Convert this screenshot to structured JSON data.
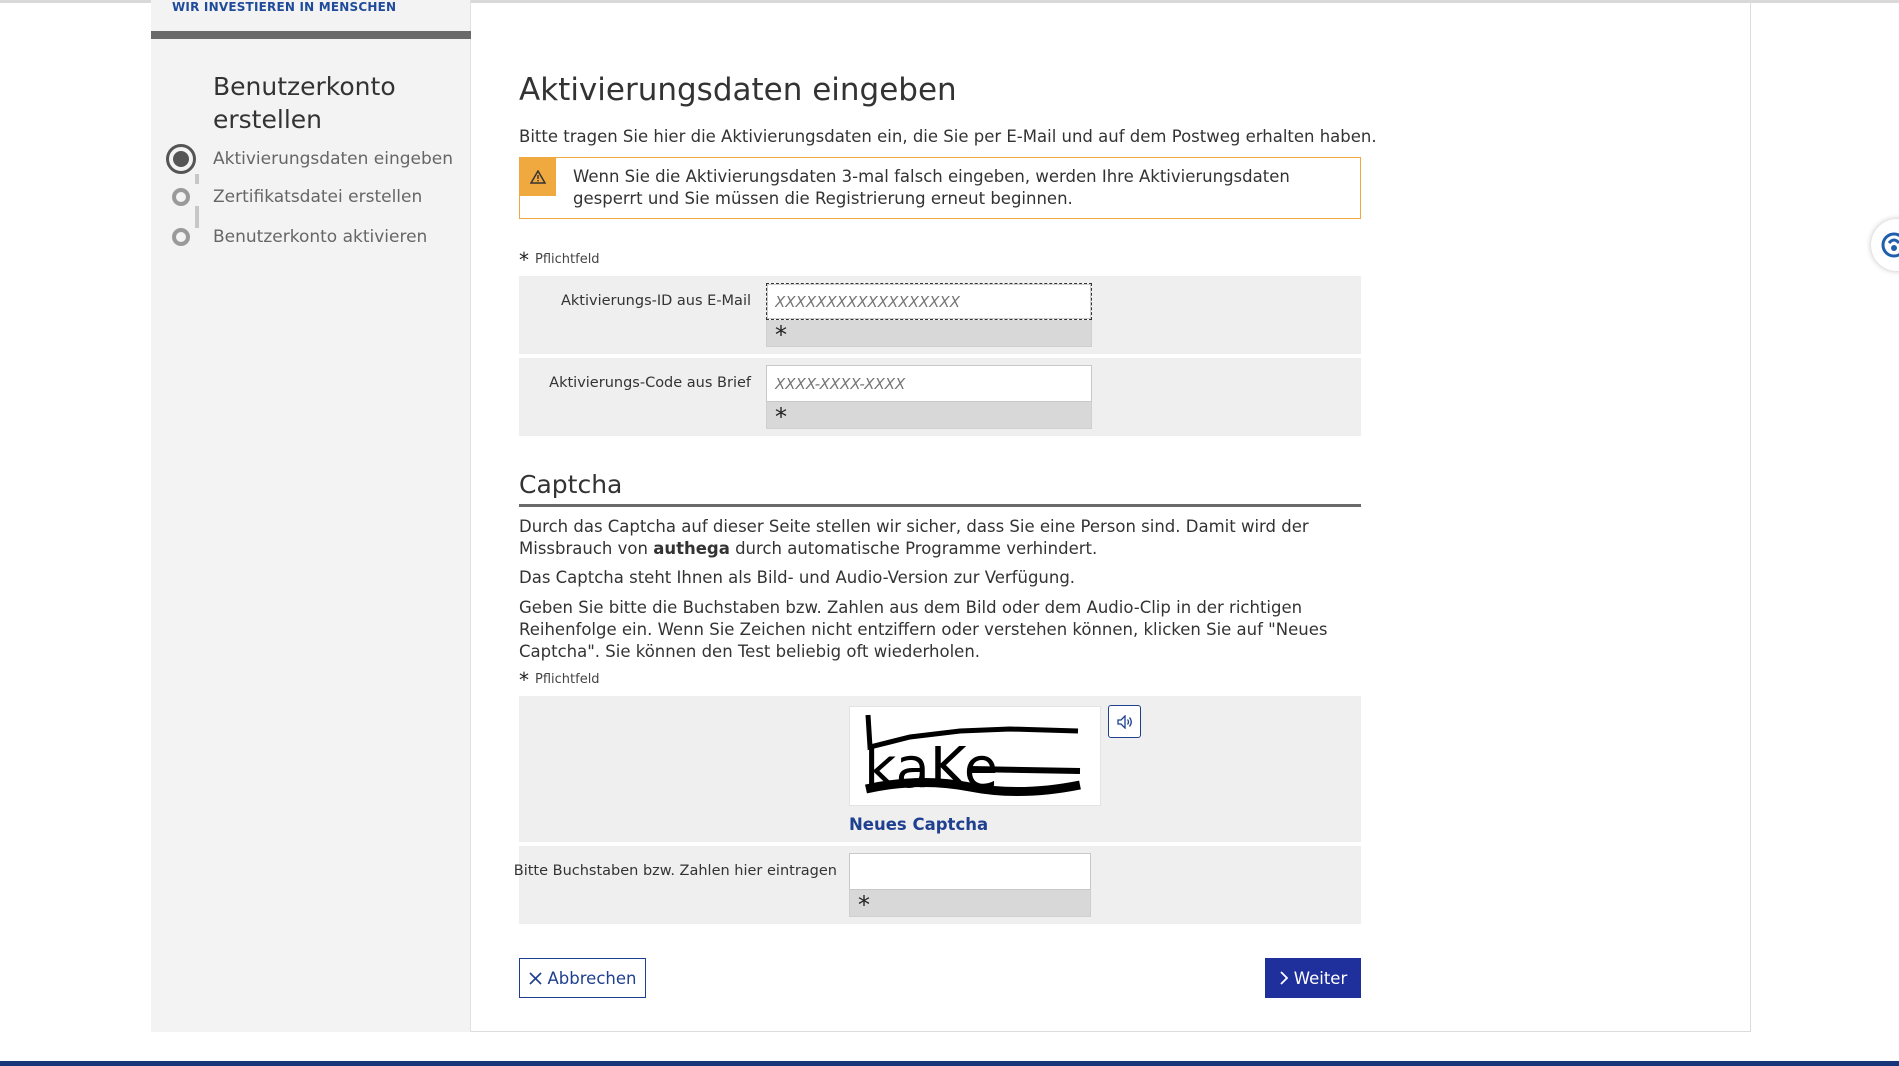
{
  "sidebar": {
    "brand": "WIR INVESTIEREN IN MENSCHEN",
    "title": "Benutzerkonto erstellen",
    "steps": [
      {
        "label": "Aktivierungsdaten eingeben"
      },
      {
        "label": "Zertifikatsdatei erstellen"
      },
      {
        "label": "Benutzerkonto aktivieren"
      }
    ]
  },
  "main": {
    "title": "Aktivierungsdaten eingeben",
    "intro": "Bitte tragen Sie hier die Aktivierungsdaten ein, die Sie per E-Mail und auf dem Postweg erhalten haben.",
    "warning": "Wenn Sie die Aktivierungsdaten 3-mal falsch eingeben, werden Ihre Aktivierungsdaten gesperrt und Sie müssen die Registrierung erneut beginnen.",
    "required_note": "Pflichtfeld",
    "required_star": "*",
    "fields": [
      {
        "label": "Aktivierungs-ID aus E-Mail",
        "placeholder": "XXXXXXXXXXXXXXXXXX",
        "value": ""
      },
      {
        "label": "Aktivierungs-Code aus Brief",
        "placeholder": "XXXX-XXXX-XXXX",
        "value": ""
      }
    ]
  },
  "captcha": {
    "title": "Captcha",
    "p1_a": "Durch das Captcha auf dieser Seite stellen wir sicher, dass Sie eine Person sind. Damit wird der Missbrauch von ",
    "p1_bold": "authega",
    "p1_b": " durch automatische Programme verhindert.",
    "p2": "Das Captcha steht Ihnen als Bild- und Audio-Version zur Verfügung.",
    "p3": "Geben Sie bitte die Buchstaben bzw. Zahlen aus dem Bild oder dem Audio-Clip in der richtigen Reihenfolge ein. Wenn Sie Zeichen nicht entziffern oder verstehen können, klicken Sie auf \"Neues Captcha\". Sie können den Test beliebig oft wiederholen.",
    "required_note": "Pflichtfeld",
    "image_text": "kaKe",
    "new_captcha": "Neues Captcha",
    "input_label": "Bitte Buchstaben bzw. Zahlen hier eintragen",
    "input_value": ""
  },
  "buttons": {
    "cancel": "Abbrechen",
    "next": "Weiter"
  },
  "colors": {
    "primary": "#1f2f9c",
    "link": "#1f3f8f",
    "warning": "#f0a93e",
    "sidebar_bg": "#f3f3f3",
    "form_row_bg": "#efefef"
  },
  "icons": {
    "warning": "warning-triangle-icon",
    "audio": "speaker-icon",
    "cancel": "close-icon",
    "next": "chevron-right-icon",
    "widget": "accessibility-widget-icon"
  }
}
